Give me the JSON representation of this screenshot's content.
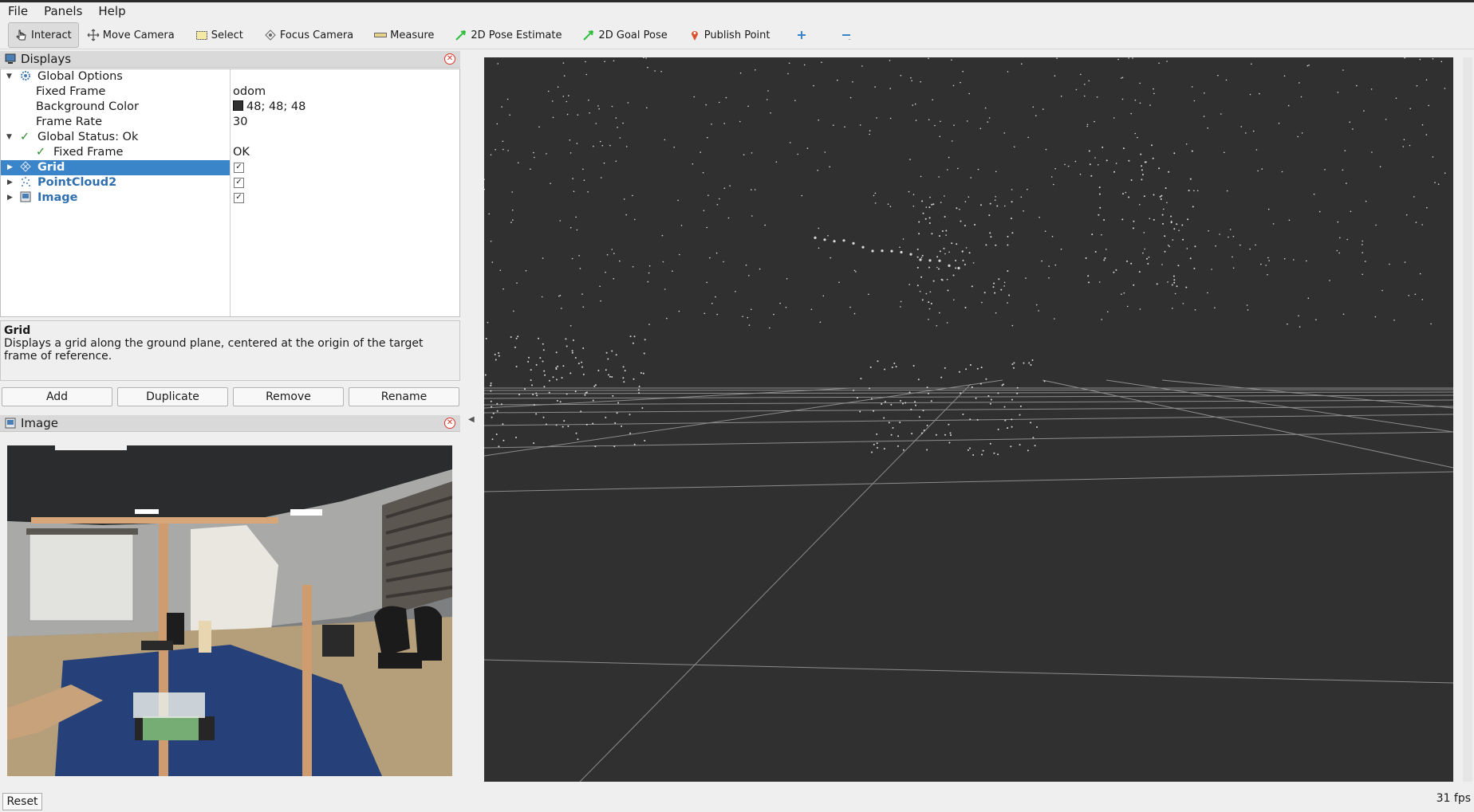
{
  "menu": [
    "File",
    "Panels",
    "Help"
  ],
  "toolbar": {
    "interact": "Interact",
    "move_camera": "Move Camera",
    "select": "Select",
    "focus_camera": "Focus Camera",
    "measure": "Measure",
    "pose_estimate": "2D Pose Estimate",
    "goal_pose": "2D Goal Pose",
    "publish_point": "Publish Point"
  },
  "displays": {
    "title": "Displays",
    "global_options": "Global Options",
    "fixed_frame_label": "Fixed Frame",
    "fixed_frame_value": "odom",
    "background_color_label": "Background Color",
    "background_color_value": "48; 48; 48",
    "background_color_swatch": "#303030",
    "frame_rate_label": "Frame Rate",
    "frame_rate_value": "30",
    "global_status": "Global Status: Ok",
    "status_fixed_frame_label": "Fixed Frame",
    "status_fixed_frame_value": "OK",
    "items": [
      {
        "name": "Grid",
        "enabled": true,
        "selected": true
      },
      {
        "name": "PointCloud2",
        "enabled": true,
        "selected": false
      },
      {
        "name": "Image",
        "enabled": true,
        "selected": false
      }
    ]
  },
  "description": {
    "title": "Grid",
    "text": "Displays a grid along the ground plane, centered at the origin of the target frame of reference."
  },
  "buttons": {
    "add": "Add",
    "duplicate": "Duplicate",
    "remove": "Remove",
    "rename": "Rename"
  },
  "image_panel": {
    "title": "Image"
  },
  "status": {
    "reset": "Reset",
    "fps": "31 fps"
  },
  "colors": {
    "selection": "#3a84c9",
    "viewport_bg": "#303030",
    "close": "#d9342b"
  }
}
